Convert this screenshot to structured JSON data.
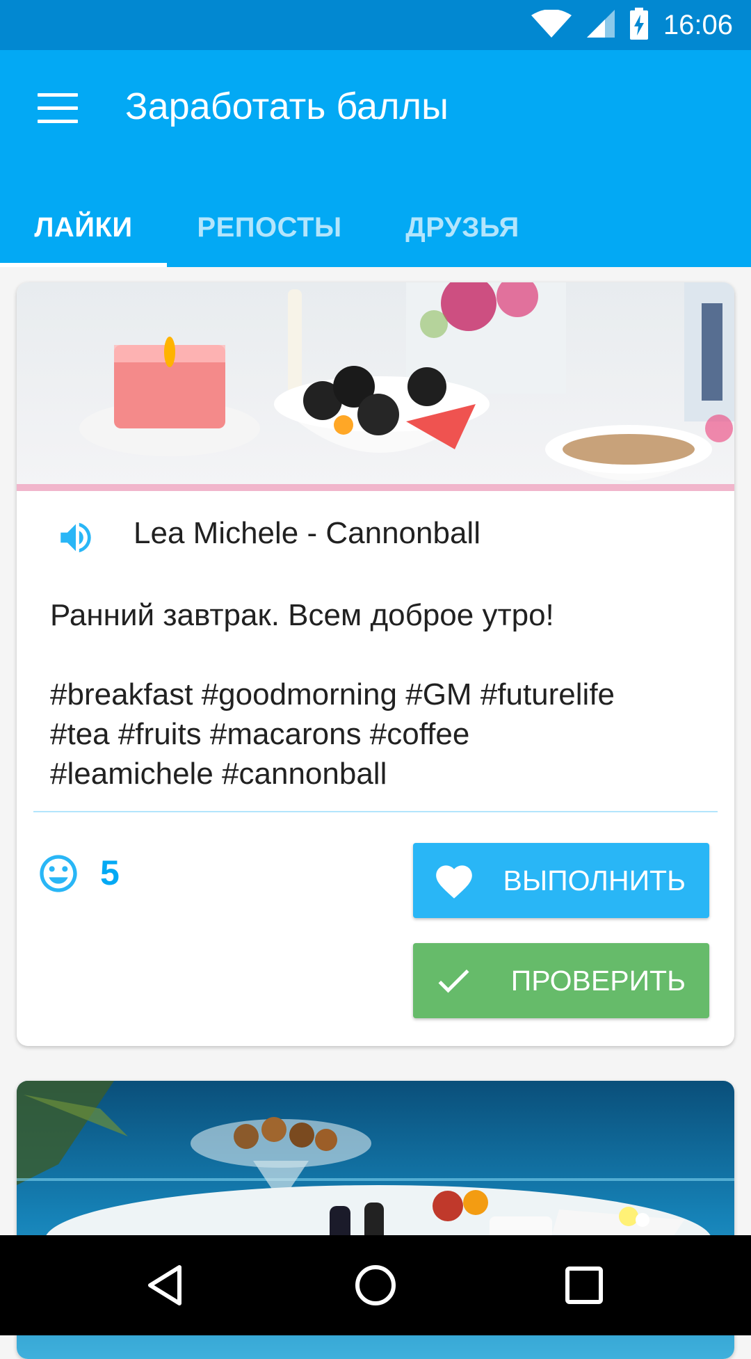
{
  "status_bar": {
    "time": "16:06"
  },
  "app_bar": {
    "title": "Заработать баллы"
  },
  "tabs": [
    {
      "label": "ЛАЙКИ",
      "active": true
    },
    {
      "label": "РЕПОСТЫ",
      "active": false
    },
    {
      "label": "ДРУЗЬЯ",
      "active": false
    }
  ],
  "post": {
    "track": "Lea Michele - Cannonball",
    "text_lines": [
      "Ранний завтрак. Всем доброе утро!"
    ],
    "hashtag_lines": [
      "#breakfast #goodmorning #GM #futurelife",
      "#tea #fruits #macarons #coffee",
      "#leamichele #cannonball"
    ],
    "count": "5",
    "do_label": "ВЫПОЛНИТЬ",
    "check_label": "ПРОВЕРИТЬ"
  },
  "colors": {
    "primary": "#03a9f4",
    "primary_dark": "#0288d1",
    "do_button": "#29b6f6",
    "check_button": "#66bb6a"
  }
}
